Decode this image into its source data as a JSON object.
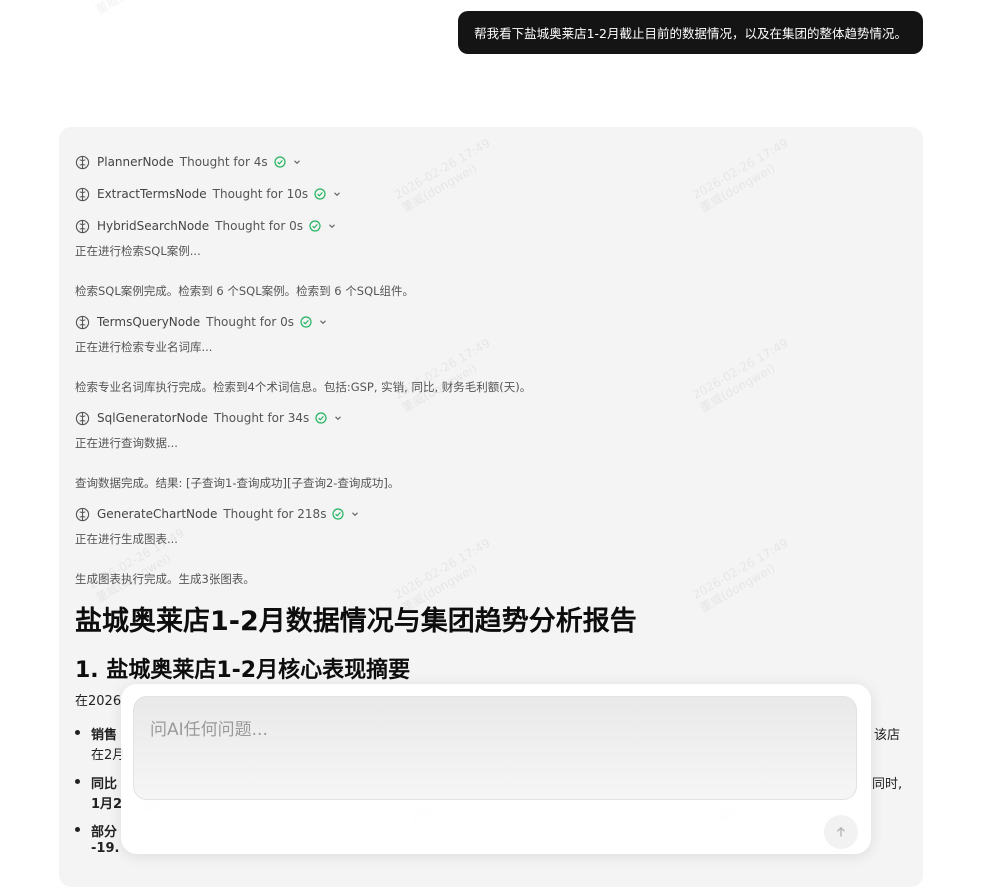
{
  "user_message": "帮我看下盐城奥莱店1-2月截止目前的数据情况，以及在集团的整体趋势情况。",
  "watermark": {
    "lines": [
      "2026-02-26 17:49",
      "董威(dongwei)"
    ]
  },
  "process": {
    "nodes": [
      {
        "name": "PlannerNode",
        "time": "Thought for 4s"
      },
      {
        "name": "ExtractTermsNode",
        "time": "Thought for 10s"
      },
      {
        "name": "HybridSearchNode",
        "time": "Thought for 0s"
      },
      {
        "name": "TermsQueryNode",
        "time": "Thought for 0s"
      },
      {
        "name": "SqlGeneratorNode",
        "time": "Thought for 34s"
      },
      {
        "name": "GenerateChartNode",
        "time": "Thought for 218s"
      }
    ],
    "status": {
      "sql_search_running": "正在进行检索SQL案例...",
      "sql_search_done": "检索SQL案例完成。检索到 6 个SQL案例。检索到 6 个SQL组件。",
      "terms_running": "正在进行检索专业名词库...",
      "terms_done": "检索专业名词库执行完成。检索到4个术词信息。包括:GSP, 实销, 同比, 财务毛利额(天)。",
      "query_running": "正在进行查询数据...",
      "query_done": "查询数据完成。结果: [子查询1-查询成功][子查询2-查询成功]。",
      "chart_running": "正在进行生成图表...",
      "chart_done": "生成图表执行完成。生成3张图表。"
    }
  },
  "report": {
    "title": "盐城奥莱店1-2月数据情况与集团趋势分析报告",
    "section1_title": "1. 盐城奥莱店1-2月核心表现摘要",
    "lead_fragment": "在2026",
    "bullets": [
      {
        "l1": "销售",
        "l2": "在2月"
      },
      {
        "l1": "同比",
        "l2": "1月2"
      },
      {
        "l1": "部分",
        "l2": "-19."
      }
    ],
    "right_fragments": [
      "该店",
      "同时,"
    ]
  },
  "composer": {
    "placeholder": "问AI任何问题...",
    "send_icon": "arrow-up-icon"
  },
  "colors": {
    "accent_check": "#22b35e",
    "user_bubble_bg": "#141414",
    "panel_bg": "#f4f4f5"
  }
}
